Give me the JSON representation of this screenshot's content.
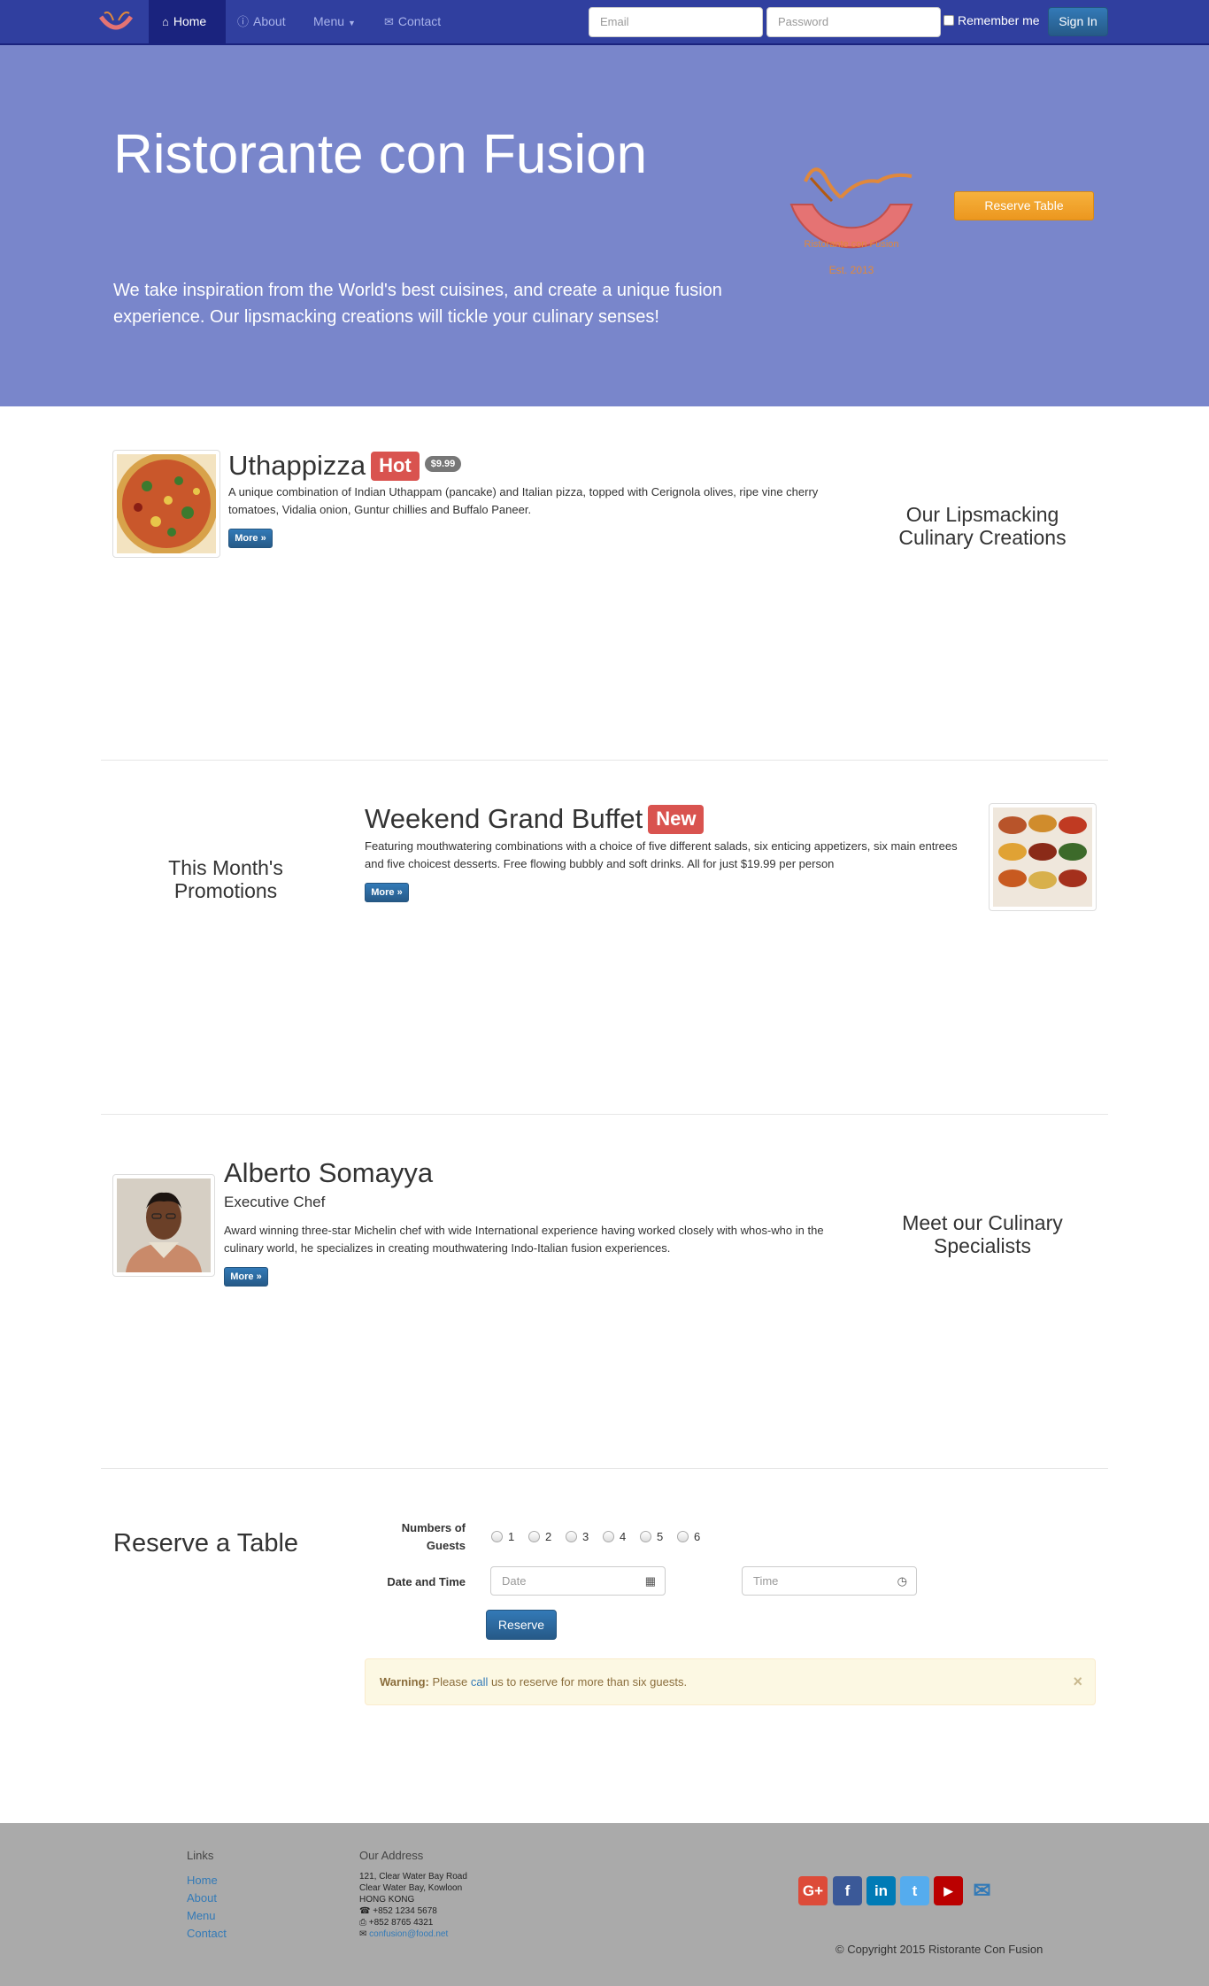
{
  "navbar": {
    "items": [
      {
        "label": "Home",
        "icon": "home-icon"
      },
      {
        "label": "About",
        "icon": "info-icon"
      },
      {
        "label": "Menu",
        "icon": "caret-down-icon"
      },
      {
        "label": "Contact",
        "icon": "envelope-icon"
      }
    ],
    "email_placeholder": "Email",
    "password_placeholder": "Password",
    "remember_label": "Remember me",
    "signin_label": "Sign In"
  },
  "jumbotron": {
    "title": "Ristorante con Fusion",
    "text": "We take inspiration from the World's best cuisines, and create a unique fusion experience. Our lipsmacking creations will tickle your culinary senses!",
    "logo_text": "Ristorante con Fusion",
    "logo_est": "Est. 2013",
    "reserve_label": "Reserve Table"
  },
  "dish": {
    "name": "Uthappizza",
    "label": "Hot",
    "price": "$9.99",
    "description": "A unique combination of Indian Uthappam (pancake) and Italian pizza, topped with Cerignola olives, ripe vine cherry tomatoes, Vidalia onion, Guntur chillies and Buffalo Paneer.",
    "more": "More »",
    "side_heading": "Our Lipsmacking Culinary Creations"
  },
  "promotion": {
    "name": "Weekend Grand Buffet",
    "label": "New",
    "description": "Featuring mouthwatering combinations with a choice of five different salads, six enticing appetizers, six main entrees and five choicest desserts. Free flowing bubbly and soft drinks. All for just $19.99 per person",
    "more": "More »",
    "side_heading": "This Month's Promotions"
  },
  "leader": {
    "name": "Alberto Somayya",
    "designation": "Executive Chef",
    "description": "Award winning three-star Michelin chef with wide International experience having worked closely with whos-who in the culinary world, he specializes in creating mouthwatering Indo-Italian fusion experiences.",
    "more": "More »",
    "side_heading": "Meet our Culinary Specialists"
  },
  "reserve": {
    "heading": "Reserve a Table",
    "guests_label": "Numbers of Guests",
    "guest_options": [
      "1",
      "2",
      "3",
      "4",
      "5",
      "6"
    ],
    "datetime_label": "Date and Time",
    "date_placeholder": "Date",
    "time_placeholder": "Time",
    "submit_label": "Reserve",
    "alert_strong": "Warning:",
    "alert_pre": "Please",
    "alert_link": "call",
    "alert_post": "us to reserve for more than six guests.",
    "alert_close": "×"
  },
  "footer": {
    "links_heading": "Links",
    "links": [
      "Home",
      "About",
      "Menu",
      "Contact"
    ],
    "address_heading": "Our Address",
    "address_lines": [
      "121, Clear Water Bay Road",
      "Clear Water Bay, Kowloon",
      "HONG KONG"
    ],
    "phone": "+852 1234 5678",
    "fax": "+852 8765 4321",
    "email": "confusion@food.net",
    "social": [
      {
        "name": "google-plus",
        "glyph": "G+",
        "color": "#dd4b39"
      },
      {
        "name": "facebook",
        "glyph": "f",
        "color": "#3b5998"
      },
      {
        "name": "linkedin",
        "glyph": "in",
        "color": "#007bb6"
      },
      {
        "name": "twitter",
        "glyph": "t",
        "color": "#55acee"
      },
      {
        "name": "youtube",
        "glyph": "▶",
        "color": "#bb0000"
      }
    ],
    "copyright": "© Copyright 2015 Ristorante Con Fusion"
  }
}
